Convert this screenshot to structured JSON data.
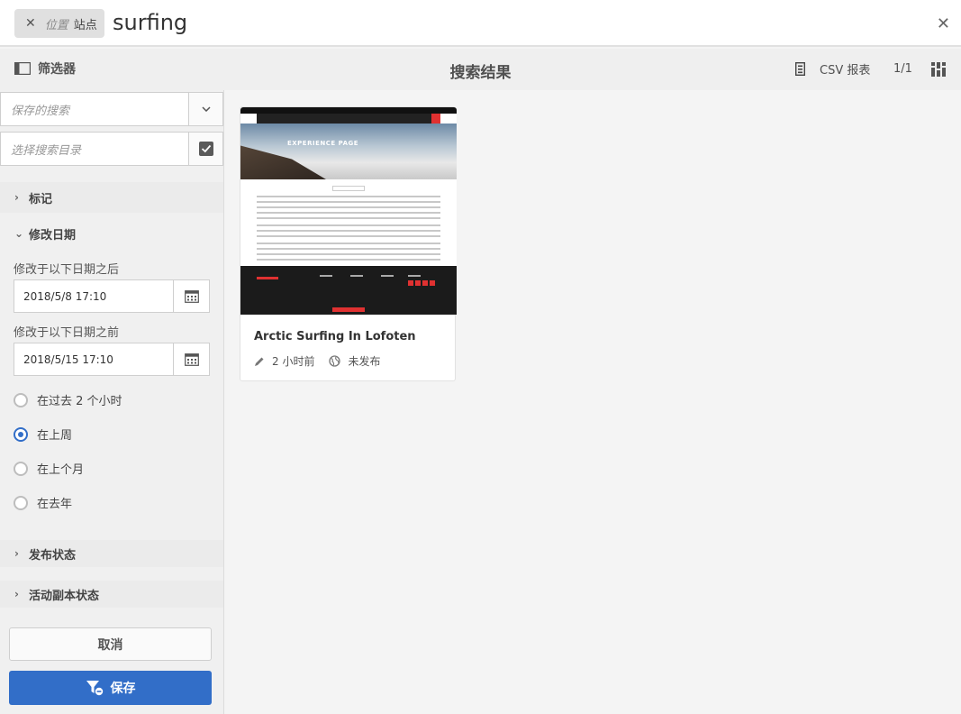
{
  "search": {
    "tag_key": "位置",
    "tag_value": "站点",
    "query": "surfing"
  },
  "subheader": {
    "filter_label": "筛选器",
    "title": "搜索结果",
    "csv_label": "CSV 报表",
    "count": "1/1"
  },
  "sidebar": {
    "saved_search_placeholder": "保存的搜索",
    "catalog_placeholder": "选择搜索目录",
    "tags_label": "标记",
    "modified_label": "修改日期",
    "after_label": "修改于以下日期之后",
    "after_value": "2018/5/8 17:10",
    "before_label": "修改于以下日期之前",
    "before_value": "2018/5/15 17:10",
    "radios": [
      {
        "label": "在过去 2 个小时",
        "checked": false
      },
      {
        "label": "在上周",
        "checked": true
      },
      {
        "label": "在上个月",
        "checked": false
      },
      {
        "label": "在去年",
        "checked": false
      }
    ],
    "publish_label": "发布状态",
    "livecopy_label": "活动副本状态",
    "cancel_label": "取消",
    "save_label": "保存"
  },
  "result": {
    "thumb_title": "EXPERIENCE PAGE",
    "title": "Arctic Surfing In Lofoten",
    "modified": "2 小时前",
    "status": "未发布"
  },
  "colors": {
    "accent": "#326ec8",
    "brand_red": "#e03131"
  }
}
